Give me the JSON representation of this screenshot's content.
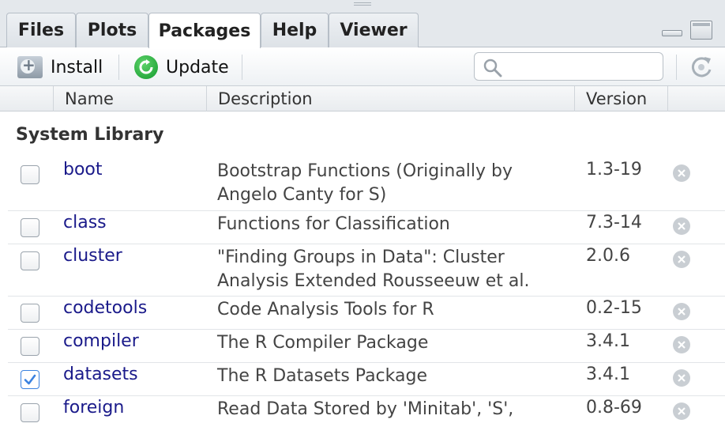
{
  "tabs": [
    {
      "label": "Files"
    },
    {
      "label": "Plots"
    },
    {
      "label": "Packages"
    },
    {
      "label": "Help"
    },
    {
      "label": "Viewer"
    }
  ],
  "active_tab": "Packages",
  "toolbar": {
    "install_label": "Install",
    "update_label": "Update",
    "search_placeholder": ""
  },
  "table": {
    "columns": {
      "name": "Name",
      "description": "Description",
      "version": "Version"
    },
    "section_title": "System Library",
    "rows": [
      {
        "name": "boot",
        "description": "Bootstrap Functions (Originally by Angelo Canty for S)",
        "version": "1.3-19",
        "checked": false
      },
      {
        "name": "class",
        "description": "Functions for Classification",
        "version": "7.3-14",
        "checked": false
      },
      {
        "name": "cluster",
        "description": "\"Finding Groups in Data\": Cluster Analysis Extended Rousseeuw et al.",
        "version": "2.0.6",
        "checked": false
      },
      {
        "name": "codetools",
        "description": "Code Analysis Tools for R",
        "version": "0.2-15",
        "checked": false
      },
      {
        "name": "compiler",
        "description": "The R Compiler Package",
        "version": "3.4.1",
        "checked": false
      },
      {
        "name": "datasets",
        "description": "The R Datasets Package",
        "version": "3.4.1",
        "checked": true
      },
      {
        "name": "foreign",
        "description": "Read Data Stored by 'Minitab', 'S',",
        "version": "0.8-69",
        "checked": false
      }
    ]
  },
  "colors": {
    "package_link": "#1a1a8a",
    "checkbox_checked": "#3b82e0",
    "update_icon": "#1aa336"
  },
  "icons": {
    "install": "install-icon",
    "update": "update-icon",
    "search": "search-icon",
    "refresh": "refresh-icon",
    "remove": "remove-icon",
    "checkmark": "checkmark-icon"
  }
}
